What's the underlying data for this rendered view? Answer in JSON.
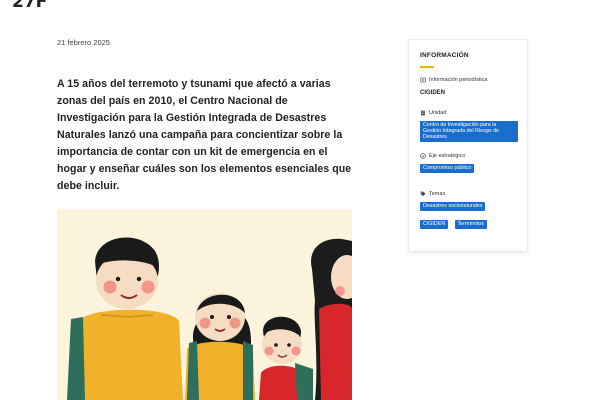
{
  "header": {
    "partial_text": "27F"
  },
  "article": {
    "date": "21 febrero 2025",
    "lead": "A 15 años del terremoto y tsunami que afectó a varias zonas del país en 2010, el Centro Nacional de Investigación para la Gestión Integrada de Desastres Naturales lanzó una campaña para concientizar sobre la importancia de contar con un kit de emergencia en el hogar y enseñar cuáles son los elementos esenciales que debe incluir."
  },
  "sidebar": {
    "title": "INFORMACIÓN",
    "sections": {
      "tipo": {
        "icon": "newspaper-icon",
        "label": "Información periodística",
        "value": "CIGIDEN"
      },
      "unidad": {
        "icon": "building-icon",
        "label": "Unidad",
        "tags": [
          "Centro de Investigación para la Gestión Integrada del Riesgo de Desastres"
        ]
      },
      "eje": {
        "icon": "check-circle-icon",
        "label": "Eje estratégico",
        "tags": [
          "Compromiso público"
        ]
      },
      "temas": {
        "icon": "tag-icon",
        "label": "Temas",
        "tags": [
          "Desastres socionaturales",
          "CIGIDEN",
          "Terremotos"
        ]
      }
    },
    "colors": {
      "accent": "#f0b400",
      "tag_bg": "#1a6ecb"
    }
  }
}
